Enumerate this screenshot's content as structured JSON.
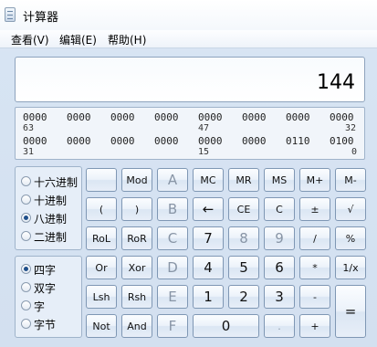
{
  "window": {
    "title": "计算器",
    "icon": "calculator-icon"
  },
  "menu": {
    "view": "查看(V)",
    "edit": "编辑(E)",
    "help": "帮助(H)"
  },
  "display": {
    "value": "144"
  },
  "bits": {
    "row1": [
      "0000",
      "0000",
      "0000",
      "0000",
      "0000",
      "0000",
      "0000",
      "0000"
    ],
    "row1_marks": [
      "63",
      "47",
      "32"
    ],
    "row2": [
      "0000",
      "0000",
      "0000",
      "0000",
      "0000",
      "0000",
      "0110",
      "0100"
    ],
    "row2_marks": [
      "31",
      "15",
      "0"
    ]
  },
  "base": {
    "hex": "十六进制",
    "dec": "十进制",
    "oct": "八进制",
    "bin": "二进制",
    "selected": "八进制"
  },
  "word": {
    "qword": "四字",
    "dword": "双字",
    "word": "字",
    "byte": "字节",
    "selected": "四字"
  },
  "keys": {
    "blank": "",
    "mod": "Mod",
    "A": "A",
    "mc": "MC",
    "mr": "MR",
    "ms": "MS",
    "mplus": "M+",
    "mminus": "M-",
    "lparen": "(",
    "rparen": ")",
    "B": "B",
    "back": "←",
    "ce": "CE",
    "c": "C",
    "plusminus": "±",
    "sqrt": "√",
    "rol": "RoL",
    "ror": "RoR",
    "C": "C",
    "n7": "7",
    "n8": "8",
    "n9": "9",
    "div": "/",
    "pct": "%",
    "or": "Or",
    "xor": "Xor",
    "D": "D",
    "n4": "4",
    "n5": "5",
    "n6": "6",
    "mul": "*",
    "recip": "1/x",
    "lsh": "Lsh",
    "rsh": "Rsh",
    "E": "E",
    "n1": "1",
    "n2": "2",
    "n3": "3",
    "sub": "-",
    "eq": "=",
    "not": "Not",
    "and": "And",
    "F": "F",
    "n0": "0",
    "dot": ".",
    "add": "+"
  }
}
